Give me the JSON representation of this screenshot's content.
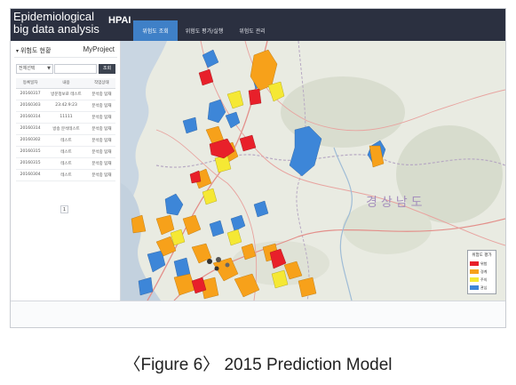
{
  "header": {
    "brand_line1": "Epidemiological",
    "brand_line2": "big data analysis",
    "system_name": "HPAI",
    "tabs": [
      {
        "label": "위험도 조회",
        "active": true
      },
      {
        "label": "위험도 평가/실행",
        "active": false
      },
      {
        "label": "위험도 관리",
        "active": false
      }
    ]
  },
  "sidebar": {
    "title": "위험도 현황",
    "project_label": "MyProject",
    "filter_select": "전체선택",
    "search_button": "조회",
    "table": {
      "columns": [
        "등록일자",
        "내용",
        "작업상태"
      ],
      "rows": [
        [
          "20160317",
          "방문정보로 테스트",
          "분석중 탑재"
        ],
        [
          "20160303",
          "23:42:9:23",
          "분석중 탑재"
        ],
        [
          "20160314",
          "11111",
          "분석중 탑재"
        ],
        [
          "20160314",
          "방송 분석테스트",
          "분석중 탑재"
        ],
        [
          "20160302",
          "테스트",
          "분석중 탑재"
        ],
        [
          "20160315",
          "테스트",
          "분석중 탑재"
        ],
        [
          "20160315",
          "테스트",
          "분석중 탑재"
        ],
        [
          "20160304",
          "테스트",
          "분석중 탑재"
        ]
      ]
    },
    "page": "1"
  },
  "map": {
    "region_label": "경상남도",
    "legend": {
      "title": "위험도 평가",
      "items": [
        {
          "label": "위험",
          "color": "#e8202a"
        },
        {
          "label": "경계",
          "color": "#f7a11a"
        },
        {
          "label": "주의",
          "color": "#f5e834"
        },
        {
          "label": "관심",
          "color": "#3d86d8"
        }
      ]
    }
  },
  "caption": "〈Figure 6〉 2015 Prediction Model"
}
